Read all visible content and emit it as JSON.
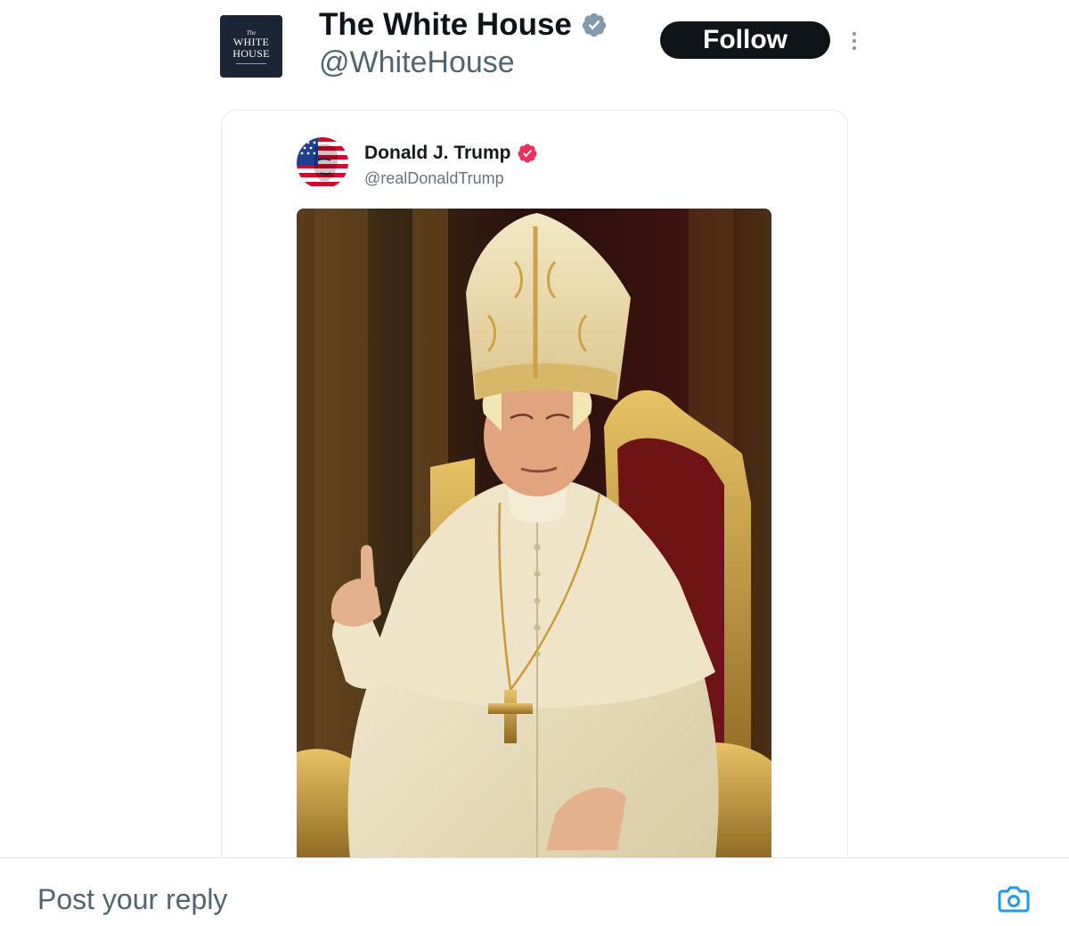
{
  "header": {
    "avatar_text": {
      "line1": "The",
      "line2": "WHITE",
      "line3": "HOUSE"
    },
    "account_name": "The White House",
    "account_handle": "@WhiteHouse",
    "follow_label": "Follow",
    "more_icon": "more-vertical-icon"
  },
  "embed": {
    "author_name": "Donald J. Trump",
    "author_handle": "@realDonaldTrump",
    "verified_color": "#e8315b"
  },
  "reply": {
    "placeholder": "Post your reply",
    "camera_icon": "camera-icon"
  },
  "colors": {
    "primary_text": "#0f1419",
    "secondary_text": "#536471",
    "follow_bg": "#0f1419",
    "accent_blue": "#1d9bf0",
    "verified_gray": "#829aab"
  }
}
